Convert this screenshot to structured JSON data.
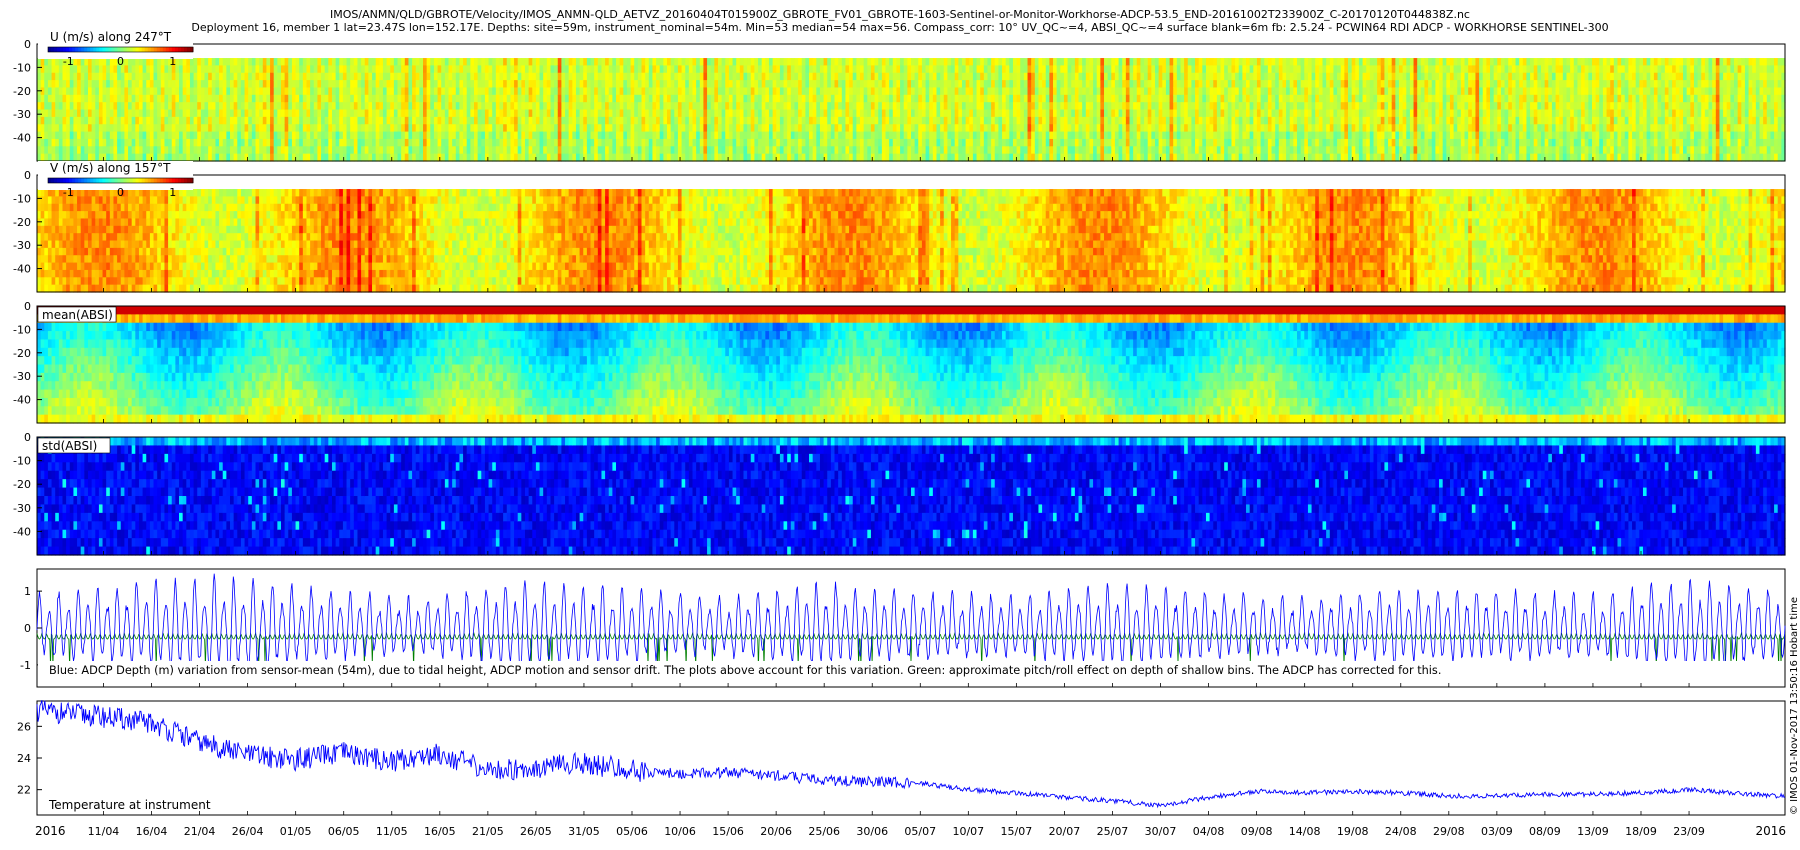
{
  "title_lines": [
    "IMOS/ANMN/QLD/GBROTE/Velocity/IMOS_ANMN-QLD_AETVZ_20160404T015900Z_GBROTE_FV01_GBROTE-1603-Sentinel-or-Monitor-Workhorse-ADCP-53.5_END-20161002T233900Z_C-20170120T044838Z.nc",
    "Deployment 16, member 1 lat=23.47S lon=152.17E. Depths: site=59m, instrument_nominal=54m. Min=53 median=54 max=56. Compass_corr: 10° UV_QC~=4, ABSI_QC~=4 surface blank=6m fb: 2.5.24 - PCWIN64 RDI ADCP - WORKHORSE SENTINEL-300"
  ],
  "credit": "© IMOS 01-Nov-2017 13:50:16 Hobart time",
  "colors": {
    "jet": [
      "#00008f",
      "#0000ff",
      "#0080ff",
      "#00ffff",
      "#80ff80",
      "#ffff00",
      "#ff8000",
      "#ff0000",
      "#800000"
    ],
    "depth_line": "#0000ff",
    "pitch_line": "#007f00",
    "temp_line": "#0000ff"
  },
  "chart_data": [
    {
      "type": "heatmap",
      "label": "U (m/s) along 247°T",
      "colorbar_ticks": [
        "-1",
        "0",
        "1"
      ],
      "clim": [
        -1.4,
        1.4
      ],
      "ylim": [
        -50,
        0
      ],
      "yticks": [
        "0",
        "-10",
        "-20",
        "-30",
        "-40"
      ],
      "blank_depth": -6,
      "description_values": {
        "typical": 0.1,
        "range": [
          -0.8,
          0.9
        ]
      }
    },
    {
      "type": "heatmap",
      "label": "V (m/s) along 157°T",
      "colorbar_ticks": [
        "-1",
        "0",
        "1"
      ],
      "clim": [
        -1.4,
        1.4
      ],
      "ylim": [
        -50,
        0
      ],
      "yticks": [
        "0",
        "-10",
        "-20",
        "-30",
        "-40"
      ],
      "blank_depth": -6,
      "description_values": {
        "typical": 0.35,
        "range": [
          -0.3,
          1.0
        ]
      }
    },
    {
      "type": "heatmap",
      "label": "mean(ABSI)",
      "ylim": [
        -50,
        0
      ],
      "yticks": [
        "0",
        "-10",
        "-20",
        "-30",
        "-40"
      ]
    },
    {
      "type": "heatmap",
      "label": "std(ABSI)",
      "ylim": [
        -50,
        0
      ],
      "yticks": [
        "0",
        "-10",
        "-20",
        "-30",
        "-40"
      ]
    },
    {
      "type": "line",
      "yticks": [
        "1",
        "0",
        "-1"
      ],
      "ylim": [
        -1.6,
        1.6
      ],
      "annotation": "Blue: ADCP Depth (m) variation from sensor-mean (54m), due to tidal height, ADCP motion and sensor drift. The plots above account for this variation. Green: approximate pitch/roll effect on depth of shallow bins. The ADCP has corrected for this.",
      "series": [
        {
          "name": "ADCP Depth variation",
          "tidal_amplitude": [
            0.9,
            1.2,
            1.4,
            1.0,
            0.8,
            1.3,
            1.1,
            0.8,
            1.2,
            1.0,
            0.9,
            1.2,
            1.0,
            0.8,
            1.1,
            1.0,
            0.9,
            1.3,
            1.0
          ]
        },
        {
          "name": "Pitch/roll effect",
          "typical": -0.3
        }
      ]
    },
    {
      "type": "line",
      "label": "Temperature at instrument",
      "yticks": [
        "26",
        "24",
        "22"
      ],
      "ylim": [
        20.4,
        27.6
      ],
      "x_dates": [
        "2016-04-04",
        "2016-04-11",
        "2016-04-16",
        "2016-04-21",
        "2016-04-26",
        "2016-05-01",
        "2016-05-06",
        "2016-05-11",
        "2016-05-16",
        "2016-05-21",
        "2016-05-26",
        "2016-05-31",
        "2016-06-05",
        "2016-06-10",
        "2016-06-15",
        "2016-06-20",
        "2016-06-25",
        "2016-06-30",
        "2016-07-05",
        "2016-07-10",
        "2016-07-15",
        "2016-07-20",
        "2016-07-25",
        "2016-07-30",
        "2016-08-04",
        "2016-08-09",
        "2016-08-14",
        "2016-08-19",
        "2016-08-24",
        "2016-08-29",
        "2016-09-03",
        "2016-09-08",
        "2016-09-13",
        "2016-09-18",
        "2016-09-23",
        "2016-10-02"
      ],
      "values": [
        27.0,
        26.6,
        26.2,
        25.0,
        24.2,
        23.9,
        24.3,
        23.8,
        24.3,
        23.2,
        23.4,
        23.7,
        23.2,
        23.0,
        23.1,
        22.9,
        22.6,
        22.5,
        22.4,
        22.0,
        21.8,
        21.5,
        21.3,
        21.0,
        21.5,
        21.9,
        21.8,
        21.9,
        21.8,
        21.6,
        21.6,
        21.7,
        21.7,
        21.8,
        22.0,
        21.6
      ]
    }
  ],
  "x_axis": {
    "year_start": "2016",
    "year_end": "2016",
    "tick_labels": [
      "11/04",
      "16/04",
      "21/04",
      "26/04",
      "01/05",
      "06/05",
      "11/05",
      "16/05",
      "21/05",
      "26/05",
      "31/05",
      "05/06",
      "10/06",
      "15/06",
      "20/06",
      "25/06",
      "30/06",
      "05/07",
      "10/07",
      "15/07",
      "20/07",
      "25/07",
      "30/07",
      "04/08",
      "09/08",
      "14/08",
      "19/08",
      "24/08",
      "29/08",
      "03/09",
      "08/09",
      "13/09",
      "18/09",
      "23/09"
    ]
  }
}
